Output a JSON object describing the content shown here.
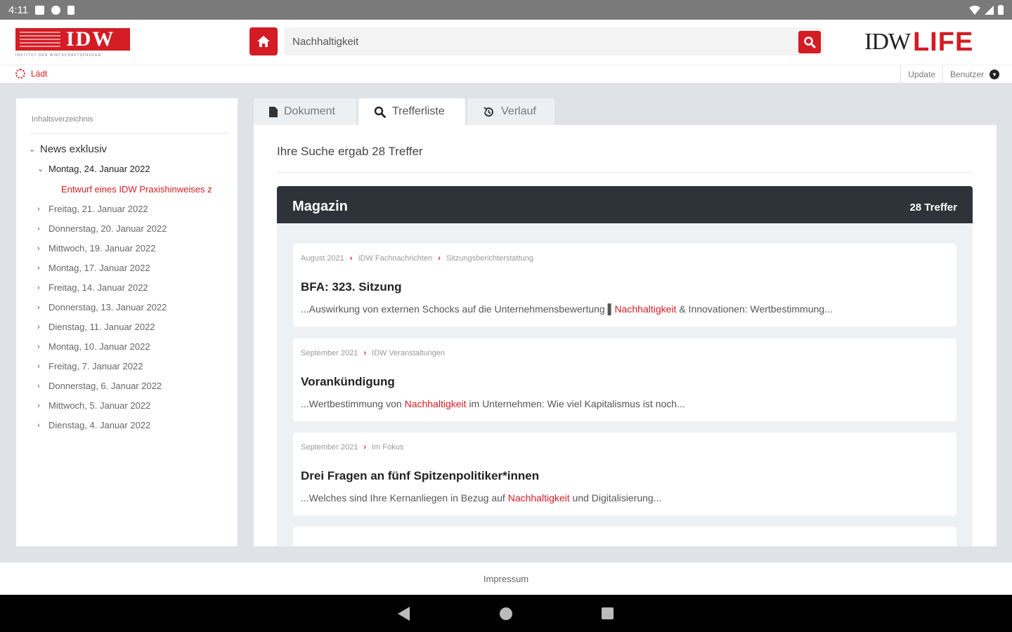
{
  "status_bar": {
    "time": "4:11"
  },
  "header": {
    "brand_logo": "IDW",
    "brand_sub": "INSTITUT DER WIRTSCHAFTSPRÜFER",
    "search_value": "Nachhaltigkeit",
    "app_logo_left": "IDW",
    "app_logo_right": "LIFE",
    "accent_color": "#d31c24"
  },
  "subbar": {
    "loading_text": "Lädt",
    "update_label": "Update",
    "user_label": "Benutzer"
  },
  "sidebar": {
    "title": "Inhaltsverzeichnis",
    "root": "News exklusiv",
    "open_day": "Montag, 24. Januar 2022",
    "open_child": "Entwurf eines IDW Praxishinweises z",
    "days": [
      "Freitag, 21. Januar 2022",
      "Donnerstag, 20. Januar 2022",
      "Mittwoch, 19. Januar 2022",
      "Montag, 17. Januar 2022",
      "Freitag, 14. Januar 2022",
      "Donnerstag, 13. Januar 2022",
      "Dienstag, 11. Januar 2022",
      "Montag, 10. Januar 2022",
      "Freitag, 7. Januar 2022",
      "Donnerstag, 6. Januar 2022",
      "Mittwoch, 5. Januar 2022",
      "Dienstag, 4. Januar 2022"
    ]
  },
  "tabs": {
    "document": "Dokument",
    "results": "Trefferliste",
    "history": "Verlauf"
  },
  "main": {
    "summary": "Ihre Suche ergab 28 Treffer",
    "section_title": "Magazin",
    "section_count": "28 Treffer",
    "results": [
      {
        "crumbs": [
          "August 2021",
          "IDW Fachnachrichten",
          "Sitzungsberichterstattung"
        ],
        "title": "BFA: 323. Sitzung",
        "snippet_before": "...Auswirkung von externen Schocks auf die Unternehmensbewertung ▌",
        "snippet_highlight": "Nachhaltigkeit",
        "snippet_after": " & Innovationen: Wertbestimmung..."
      },
      {
        "crumbs": [
          "September 2021",
          "IDW Veranstaltungen"
        ],
        "title": "Vorankündigung",
        "snippet_before": "...Wertbestimmung von ",
        "snippet_highlight": "Nachhaltigkeit",
        "snippet_after": " im Unternehmen: Wie viel Kapitalismus ist noch..."
      },
      {
        "crumbs": [
          "September 2021",
          "Im Fokus"
        ],
        "title": "Drei Fragen an fünf Spitzenpolitiker*innen",
        "snippet_before": "...Welches sind Ihre Kernanliegen in Bezug auf ",
        "snippet_highlight": "Nachhaltigkeit",
        "snippet_after": " und Digitalisierung..."
      }
    ]
  },
  "footer": {
    "imprint": "Impressum"
  }
}
